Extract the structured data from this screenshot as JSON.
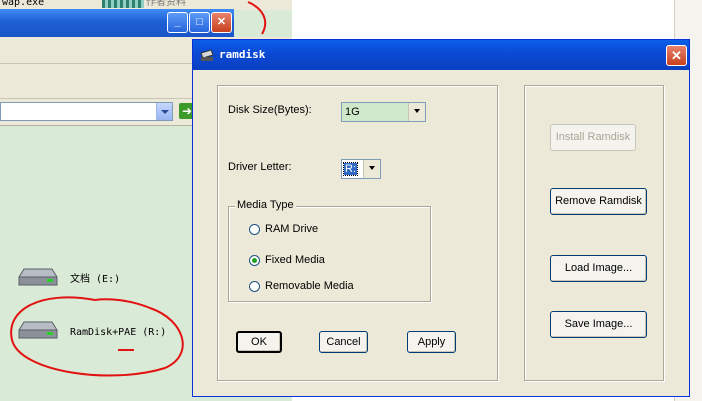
{
  "background": {
    "top_filename": "wap.exe",
    "top_right_text": "作者资料",
    "drives": [
      {
        "label": "文档 (E:)"
      },
      {
        "label": "RamDisk+PAE (R:)"
      }
    ]
  },
  "dialog": {
    "title": "ramdisk",
    "disk_size_label": "Disk Size(Bytes):",
    "disk_size_value": "1G",
    "driver_letter_label": "Driver Letter:",
    "driver_letter_value": "R:",
    "media_type_legend": "Media Type",
    "media_options": [
      {
        "label": "RAM Drive",
        "checked": false
      },
      {
        "label": "Fixed Media",
        "checked": true
      },
      {
        "label": "Removable Media",
        "checked": false
      }
    ],
    "ok_label": "OK",
    "cancel_label": "Cancel",
    "apply_label": "Apply",
    "install_label": "Install Ramdisk",
    "remove_label": "Remove Ramdisk",
    "load_label": "Load Image...",
    "save_label": "Save Image..."
  },
  "colors": {
    "title_blue": "#0b4bd6",
    "annotation_red": "#e31212",
    "selected_field": "#cfe8c9"
  }
}
